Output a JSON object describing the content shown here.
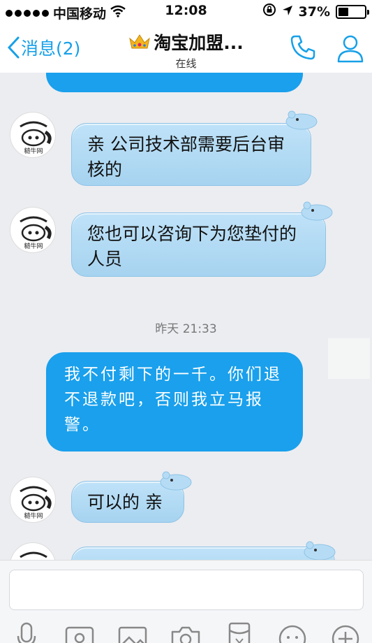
{
  "status_bar": {
    "carrier": "中国移动",
    "time": "12:08",
    "battery": "37%"
  },
  "nav": {
    "back_label": "消息(2)",
    "title": "淘宝加盟...",
    "subtitle": "在线"
  },
  "messages": [
    {
      "side": "in",
      "text": "亲 公司技术部需要后台审核的"
    },
    {
      "side": "in",
      "text": "您也可以咨询下为您垫付的人员"
    },
    {
      "side": "out",
      "text": "我不付剩下的一千。你们退不退款吧，否则我立马报警。"
    },
    {
      "side": "in",
      "text": "可以的 亲"
    }
  ],
  "avatar_text": "糙牛网",
  "timestamp": "昨天 21:33",
  "colors": {
    "accent": "#17a0e8",
    "bubble_out": "#1aa0ec",
    "bubble_in": "#a6d3f0"
  },
  "icons": [
    "back-arrow-icon",
    "crown-icon",
    "phone-icon",
    "profile-icon",
    "microphone-icon",
    "video-icon",
    "image-icon",
    "camera-icon",
    "red-packet-icon",
    "emoji-icon",
    "plus-icon"
  ]
}
